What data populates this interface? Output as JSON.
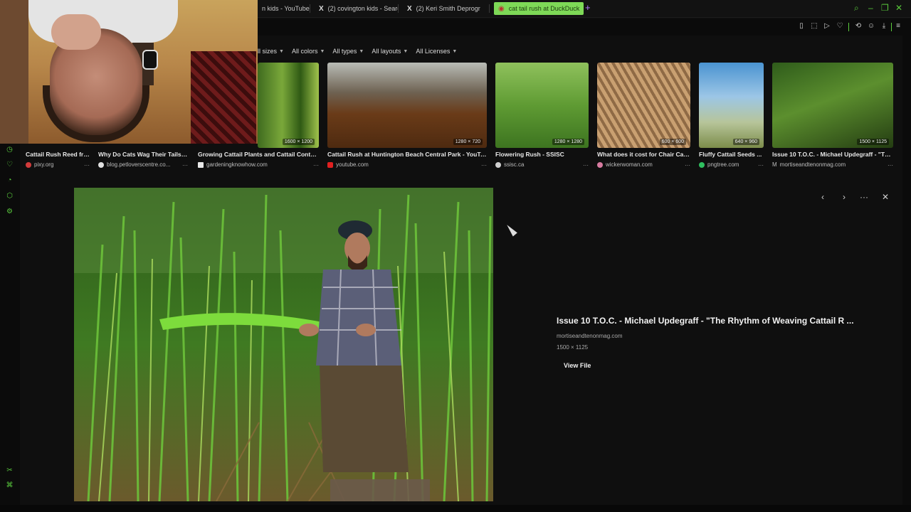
{
  "tabs": [
    {
      "label": "n kids - YouTube",
      "icon": "youtube-icon"
    },
    {
      "label": "(2) covington kids - Search",
      "icon": "x-icon",
      "glyph": "X"
    },
    {
      "label": "(2) Keri Smith Deprogr",
      "icon": "x-icon",
      "glyph": "X"
    },
    {
      "label": "cat tail rush at DuckDuck",
      "icon": "duckduckgo-icon",
      "glyph": "◉",
      "active": true
    }
  ],
  "new_tab": "+",
  "filters": [
    "ll sizes",
    "All colors",
    "All types",
    "All layouts",
    "All Licenses"
  ],
  "thumbnails": [
    {
      "title": "Cattail Rush Reed fre...",
      "source": "pixy.org",
      "size": "",
      "favicon_color": "#d23b3b"
    },
    {
      "title": "Why Do Cats Wag Their Tails: ...",
      "source": "blog.petloverscentre.co...",
      "size": "",
      "favicon_color": "#e0e0e0"
    },
    {
      "title": "Growing Cattail Plants and Cattail Control...",
      "source": "gardeningknowhow.com",
      "size": "1600 × 1200",
      "favicon_color": "#e8e8e8"
    },
    {
      "title": "Cattail Rush at Huntington Beach Central Park - YouTube",
      "source": "youtube.com",
      "size": "1280 × 720",
      "favicon_color": "#e02020"
    },
    {
      "title": "Flowering Rush - SSISC",
      "source": "ssisc.ca",
      "size": "1280 × 1280",
      "favicon_color": "#cfcfcf"
    },
    {
      "title": "What does it cost for Chair Cani...",
      "source": "wickerwoman.com",
      "size": "600 × 600",
      "favicon_color": "#d77ba0"
    },
    {
      "title": "Fluffy Cattail Seeds ...",
      "source": "pngtree.com",
      "size": "640 × 960",
      "favicon_color": "#2fbf5f"
    },
    {
      "title": "Issue 10 T.O.C. - Michael Updegraff - \"The ...",
      "source": "mortiseandtenonmag.com",
      "size": "1500 × 1125",
      "favicon_color": "#999999",
      "favicon_letter": "M"
    }
  ],
  "detail": {
    "title": "Issue 10 T.O.C. - Michael Updegraff - \"The Rhythm of Weaving Cattail R ...",
    "domain": "mortiseandtenonmag.com",
    "dimensions": "1500 × 1125",
    "view_file": "View File",
    "prev": "‹",
    "next": "›",
    "more": "···",
    "close": "✕"
  },
  "more_label": "···"
}
